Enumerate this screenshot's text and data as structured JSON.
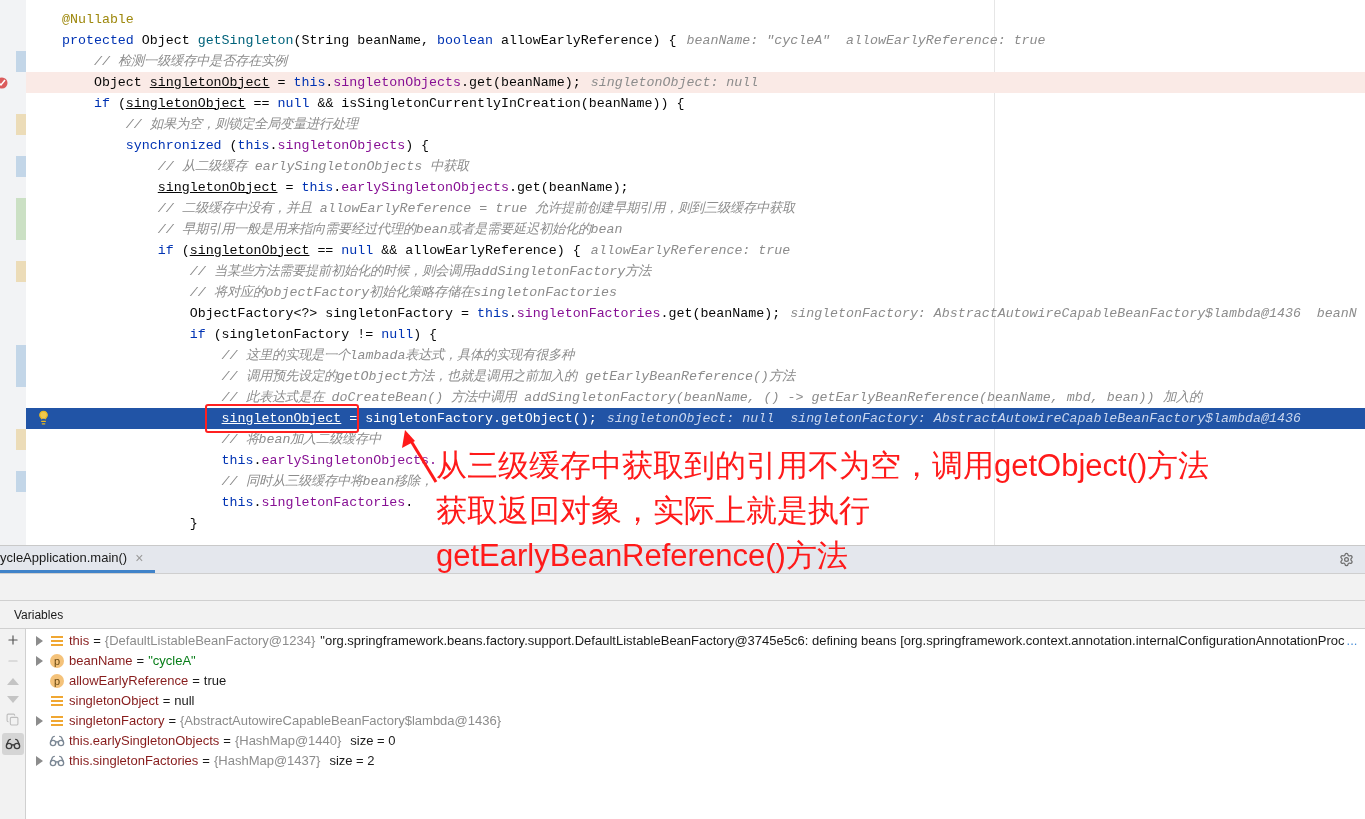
{
  "editor": {
    "lines": [
      {
        "kind": "code",
        "segments": [
          {
            "text": "@Nullable",
            "kind": "annotation"
          }
        ]
      },
      {
        "kind": "code",
        "segments": [
          {
            "text": "protected ",
            "kind": "keyword"
          },
          {
            "text": "Object ",
            "kind": "plain"
          },
          {
            "text": "getSingleton",
            "kind": "method"
          },
          {
            "text": "(String beanName, ",
            "kind": "plain"
          },
          {
            "text": "boolean ",
            "kind": "keyword"
          },
          {
            "text": "allowEarlyReference) {",
            "kind": "plain"
          }
        ],
        "hint": "beanName: \"cycleA\"  allowEarlyReference: true"
      },
      {
        "kind": "code",
        "marker": {
          "color": "#c3d6e8"
        },
        "segments": [
          {
            "text": "    // 检测一级缓存中是否存在实例",
            "kind": "comment"
          }
        ]
      },
      {
        "kind": "breakpoint",
        "segments": [
          {
            "text": "    Object ",
            "kind": "plain"
          },
          {
            "text": "singletonObject",
            "kind": "local"
          },
          {
            "text": " = ",
            "kind": "plain"
          },
          {
            "text": "this",
            "kind": "keyword"
          },
          {
            "text": ".",
            "kind": "plain"
          },
          {
            "text": "singletonObjects",
            "kind": "field"
          },
          {
            "text": ".get(beanName);",
            "kind": "plain"
          }
        ],
        "hint": "singletonObject: null"
      },
      {
        "kind": "code",
        "segments": [
          {
            "text": "    if ",
            "kind": "keyword"
          },
          {
            "text": "(",
            "kind": "plain"
          },
          {
            "text": "singletonObject",
            "kind": "local"
          },
          {
            "text": " == ",
            "kind": "plain"
          },
          {
            "text": "null",
            "kind": "keyword"
          },
          {
            "text": " && isSingletonCurrentlyInCreation(beanName)) {",
            "kind": "plain"
          }
        ]
      },
      {
        "kind": "code",
        "marker": {
          "color": "#ecdcb8"
        },
        "segments": [
          {
            "text": "        // 如果为空，则锁定全局变量进行处理",
            "kind": "comment"
          }
        ]
      },
      {
        "kind": "code",
        "segments": [
          {
            "text": "        synchronized ",
            "kind": "keyword"
          },
          {
            "text": "(",
            "kind": "plain"
          },
          {
            "text": "this",
            "kind": "keyword"
          },
          {
            "text": ".",
            "kind": "plain"
          },
          {
            "text": "singletonObjects",
            "kind": "field"
          },
          {
            "text": ") {",
            "kind": "plain"
          }
        ]
      },
      {
        "kind": "code",
        "marker": {
          "color": "#c3d6e8"
        },
        "segments": [
          {
            "text": "            // 从二级缓存 earlySingletonObjects 中获取",
            "kind": "comment"
          }
        ]
      },
      {
        "kind": "code",
        "segments": [
          {
            "text": "            singletonObject",
            "kind": "local"
          },
          {
            "text": " = ",
            "kind": "plain"
          },
          {
            "text": "this",
            "kind": "keyword"
          },
          {
            "text": ".",
            "kind": "plain"
          },
          {
            "text": "earlySingletonObjects",
            "kind": "field"
          },
          {
            "text": ".get(beanName);",
            "kind": "plain"
          }
        ]
      },
      {
        "kind": "code",
        "marker": {
          "color": "#cbe0c4"
        },
        "segments": [
          {
            "text": "            // 二级缓存中没有，并且 allowEarlyReference = true 允许提前创建早期引用，则到三级缓存中获取",
            "kind": "comment"
          }
        ]
      },
      {
        "kind": "code",
        "marker": {
          "color": "#cbe0c4"
        },
        "segments": [
          {
            "text": "            // 早期引用一般是用来指向需要经过代理的bean或者是需要延迟初始化的bean",
            "kind": "comment"
          }
        ]
      },
      {
        "kind": "code",
        "segments": [
          {
            "text": "            if ",
            "kind": "keyword"
          },
          {
            "text": "(",
            "kind": "plain"
          },
          {
            "text": "singletonObject",
            "kind": "local"
          },
          {
            "text": " == ",
            "kind": "plain"
          },
          {
            "text": "null",
            "kind": "keyword"
          },
          {
            "text": " && allowEarlyReference) {",
            "kind": "plain"
          }
        ],
        "hint": "allowEarlyReference: true"
      },
      {
        "kind": "code",
        "marker": {
          "color": "#ecdcb8"
        },
        "segments": [
          {
            "text": "                // 当某些方法需要提前初始化的时候，则会调用addSingletonFactory方法",
            "kind": "comment"
          }
        ]
      },
      {
        "kind": "code",
        "segments": [
          {
            "text": "                // 将对应的objectFactory初始化策略存储在singletonFactories",
            "kind": "comment"
          }
        ]
      },
      {
        "kind": "code",
        "segments": [
          {
            "text": "                ObjectFactory<?> singletonFactory = ",
            "kind": "plain"
          },
          {
            "text": "this",
            "kind": "keyword"
          },
          {
            "text": ".",
            "kind": "plain"
          },
          {
            "text": "singletonFactories",
            "kind": "field"
          },
          {
            "text": ".get(beanName);",
            "kind": "plain"
          }
        ],
        "hint": "singletonFactory: AbstractAutowireCapableBeanFactory$lambda@1436  beanN"
      },
      {
        "kind": "code",
        "segments": [
          {
            "text": "                if ",
            "kind": "keyword"
          },
          {
            "text": "(singletonFactory != ",
            "kind": "plain"
          },
          {
            "text": "null",
            "kind": "keyword"
          },
          {
            "text": ") {",
            "kind": "plain"
          }
        ]
      },
      {
        "kind": "code",
        "marker": {
          "color": "#c3d6e8"
        },
        "segments": [
          {
            "text": "                    // 这里的实现是一个lambada表达式，具体的实现有很多种",
            "kind": "comment"
          }
        ]
      },
      {
        "kind": "code",
        "marker": {
          "color": "#c3d6e8"
        },
        "segments": [
          {
            "text": "                    // 调用预先设定的getObject方法，也就是调用之前加入的 getEarlyBeanReference()方法",
            "kind": "comment"
          }
        ]
      },
      {
        "kind": "code",
        "segments": [
          {
            "text": "                    // 此表达式是在 doCreateBean() 方法中调用 addSingletonFactory(beanName, () -> getEarlyBeanReference(beanName, mbd, bean)) 加入的",
            "kind": "comment"
          }
        ]
      },
      {
        "kind": "execution",
        "segments": [
          {
            "text": "                    singletonObject",
            "kind": "local"
          },
          {
            "text": " =",
            "kind": "plain"
          },
          {
            "text": " singletonFactory.getObject();",
            "kind": "plain"
          }
        ],
        "hint": "singletonObject: null  singletonFactory: AbstractAutowireCapableBeanFactory$lambda@1436"
      },
      {
        "kind": "code",
        "marker": {
          "color": "#ecdcb8"
        },
        "segments": [
          {
            "text": "                    // 将bean加入二级缓存中",
            "kind": "comment"
          }
        ]
      },
      {
        "kind": "code",
        "segments": [
          {
            "text": "                    this",
            "kind": "keyword"
          },
          {
            "text": ".",
            "kind": "plain"
          },
          {
            "text": "earlySingletonObjects.",
            "kind": "field"
          }
        ]
      },
      {
        "kind": "code",
        "marker": {
          "color": "#c3d6e8"
        },
        "segments": [
          {
            "text": "                    // 同时从三级缓存中将bean移除，",
            "kind": "comment"
          }
        ]
      },
      {
        "kind": "code",
        "segments": [
          {
            "text": "                    this",
            "kind": "keyword"
          },
          {
            "text": ".",
            "kind": "plain"
          },
          {
            "text": "singletonFactories",
            "kind": "field"
          },
          {
            "text": ".",
            "kind": "plain"
          }
        ]
      },
      {
        "kind": "code",
        "segments": [
          {
            "text": "                }",
            "kind": "plain"
          }
        ]
      }
    ]
  },
  "debug_panel": {
    "tab": {
      "label": "ycleApplication.main()",
      "close": "×",
      "selected": true
    },
    "variables_title": "Variables",
    "variables": [
      {
        "expandable": true,
        "kind": "field",
        "name": "this",
        "operator": "=",
        "ref": "{DefaultListableBeanFactory@1234}",
        "value": {
          "text": "\"org.springframework.beans.factory.support.DefaultListableBeanFactory@3745e5c6: defining beans [org.springframework.context.annotation.internalConfigurationAnnotationProc",
          "kind": "plain"
        },
        "link": "..."
      },
      {
        "expandable": true,
        "kind": "param",
        "badge": "p",
        "name": "beanName",
        "operator": "=",
        "value": {
          "text": "\"cycleA\"",
          "kind": "string"
        }
      },
      {
        "expandable": false,
        "kind": "param",
        "badge": "p",
        "name": "allowEarlyReference",
        "operator": "=",
        "value": {
          "text": "true",
          "kind": "plain"
        }
      },
      {
        "expandable": false,
        "kind": "field",
        "name": "singletonObject",
        "operator": "=",
        "value": {
          "text": "null",
          "kind": "plain"
        }
      },
      {
        "expandable": true,
        "kind": "field",
        "name": "singletonFactory",
        "operator": "=",
        "ref": "{AbstractAutowireCapableBeanFactory$lambda@1436}"
      },
      {
        "expandable": false,
        "kind": "watch",
        "name": "this.earlySingletonObjects",
        "operator": "=",
        "ref": "{HashMap@1440}",
        "extra": "size = 0"
      },
      {
        "expandable": true,
        "kind": "watch",
        "name": "this.singletonFactories",
        "operator": "=",
        "ref": "{HashMap@1437}",
        "extra": "size = 2"
      }
    ]
  },
  "callout": {
    "lines": [
      "从三级缓存中获取到的引用不为空，调用getObject()方法",
      "获取返回对象，实际上就是执行",
      "getEarlyBeanReference()方法"
    ]
  }
}
